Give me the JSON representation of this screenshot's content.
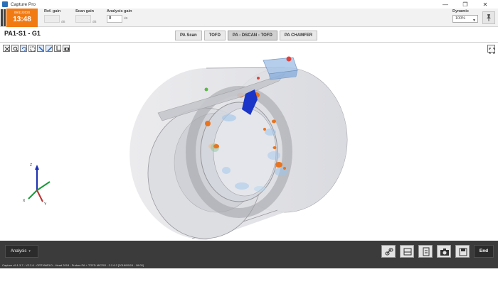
{
  "window": {
    "title": "Capture Pro",
    "minimize_glyph": "—",
    "maximize_glyph": "❐",
    "close_glyph": "✕"
  },
  "header": {
    "date": "09/11/2020",
    "time": "13:48",
    "ref_gain": {
      "label": "Ref. gain",
      "value": "",
      "unit": "dB"
    },
    "scan_gain": {
      "label": "Scan gain",
      "value": "",
      "unit": "dB"
    },
    "analysis_gain": {
      "label": "Analysis gain",
      "value": "0",
      "unit": "dB"
    },
    "dynamic": {
      "label": "Dynamic",
      "value": "100%"
    },
    "pin_icon": "pin-icon"
  },
  "view": {
    "title": "PA1-S1 - G1",
    "tabs": [
      {
        "label": "PA Scan",
        "active": false
      },
      {
        "label": "TOFD",
        "active": false
      },
      {
        "label": "PA - DSCAN - TOFD",
        "active": true
      },
      {
        "label": "PA CHAMFER",
        "active": false
      }
    ]
  },
  "toolbar": {
    "tools": [
      "fit-view-icon",
      "zoom-icon",
      "rotate-icon",
      "select-icon",
      "pan-icon",
      "measure-icon",
      "crop-icon",
      "camera-view-icon"
    ],
    "expand_icon": "expand-icon"
  },
  "axes": {
    "x": "X",
    "y": "Y",
    "z": "Z"
  },
  "bottom": {
    "analysis_label": "Analysis",
    "analysis_caret": "▾",
    "buttons": [
      "link-icon",
      "layout-icon",
      "report-icon",
      "camera-icon",
      "save-icon"
    ],
    "end_label": "End"
  },
  "status": {
    "text": "Capture v5.1.3.7 - V2.2.6 - ORTHWELD - Head 2018 - Probes PA + TOFD MICRO - 2.2.6.2 [2018/05/24 - 18:05]"
  },
  "colors": {
    "clock_bg": "#f27a12",
    "bottom_bg": "#3b3b3b",
    "indication_red": "#e0413a",
    "indication_orange": "#e87420",
    "probe_blue": "#1a35c8"
  }
}
